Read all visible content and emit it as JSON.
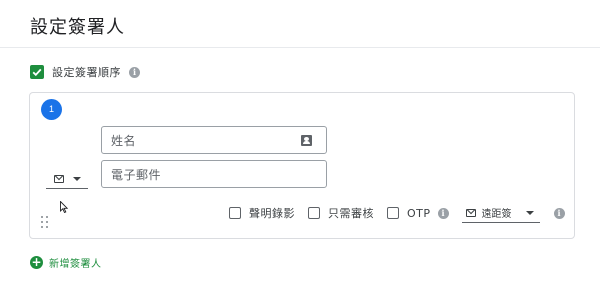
{
  "header": {
    "title": "設定簽署人"
  },
  "order": {
    "label": "設定簽署順序",
    "checked": true,
    "info_icon": "info-icon"
  },
  "signer": {
    "index": "1",
    "name_placeholder": "姓名",
    "email_placeholder": "電子郵件",
    "method_icon": "mail-icon",
    "options": [
      {
        "label": "聲明錄影",
        "checked": false
      },
      {
        "label": "只需審核",
        "checked": false
      },
      {
        "label": "OTP",
        "checked": false
      }
    ],
    "delivery": {
      "icon": "mail-icon",
      "label": "遠距簽"
    }
  },
  "add_signer": {
    "label": "新增簽署人",
    "icon": "add-circle-icon"
  },
  "colors": {
    "accent_green": "#1e8e3e",
    "badge_blue": "#1a73e8",
    "border": "#dadce0"
  }
}
